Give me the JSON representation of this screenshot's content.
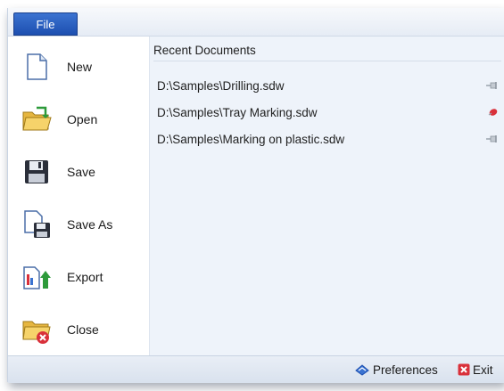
{
  "menu": {
    "file_tab": "File",
    "items": [
      {
        "label": "New",
        "icon": "new-document-icon"
      },
      {
        "label": "Open",
        "icon": "open-folder-icon"
      },
      {
        "label": "Save",
        "icon": "save-disk-icon"
      },
      {
        "label": "Save As",
        "icon": "save-as-icon"
      },
      {
        "label": "Export",
        "icon": "export-icon"
      },
      {
        "label": "Close",
        "icon": "close-folder-icon"
      }
    ]
  },
  "recent": {
    "title": "Recent Documents",
    "documents": [
      {
        "path": "D:\\Samples\\Drilling.sdw",
        "pinned": false
      },
      {
        "path": "D:\\Samples\\Tray Marking.sdw",
        "pinned": true
      },
      {
        "path": "D:\\Samples\\Marking on plastic.sdw",
        "pinned": false
      }
    ]
  },
  "footer": {
    "preferences_label": "Preferences",
    "exit_label": "Exit"
  },
  "colors": {
    "file_tab": "#2a5fc4",
    "panel_bg": "#eef3fa",
    "pin_active": "#d9303a",
    "exit_icon": "#d9303a"
  }
}
